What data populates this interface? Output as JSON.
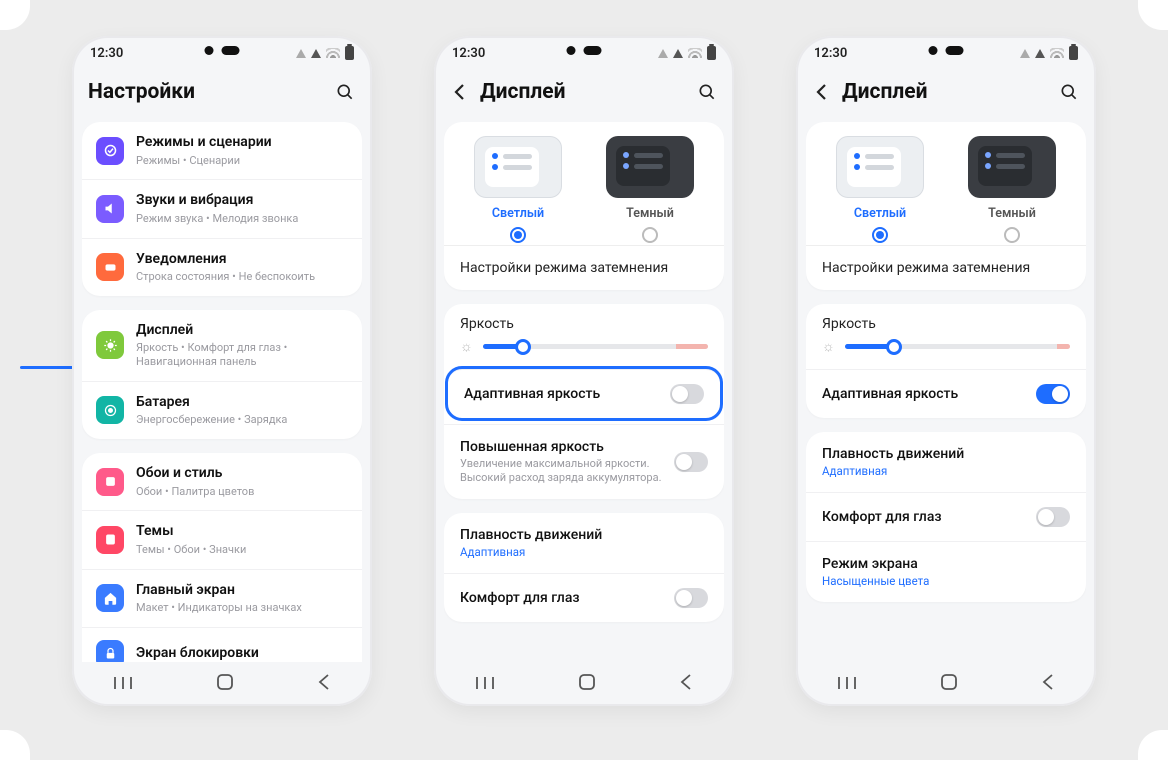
{
  "status_time": "12:30",
  "phone1": {
    "title": "Настройки",
    "groups": [
      {
        "items": [
          {
            "icon": "modes",
            "color": "#6b4eff",
            "title": "Режимы и сценарии",
            "sub": "Режимы  •  Сценарии"
          },
          {
            "icon": "sound",
            "color": "#7b5cff",
            "title": "Звуки и вибрация",
            "sub": "Режим звука  •  Мелодия звонка"
          },
          {
            "icon": "notif",
            "color": "#ff6a3d",
            "title": "Уведомления",
            "sub": "Строка состояния  •  Не беспокоить"
          }
        ]
      },
      {
        "items": [
          {
            "icon": "display",
            "color": "#7fc93c",
            "title": "Дисплей",
            "sub": "Яркость  •  Комфорт для глаз  •  Навигационная панель",
            "point": true
          },
          {
            "icon": "battery",
            "color": "#12b5a5",
            "title": "Батарея",
            "sub": "Энергосбережение  •  Зарядка"
          }
        ]
      },
      {
        "items": [
          {
            "icon": "wall",
            "color": "#ff5a8a",
            "title": "Обои и стиль",
            "sub": "Обои  •  Палитра цветов"
          },
          {
            "icon": "themes",
            "color": "#ff4765",
            "title": "Темы",
            "sub": "Темы  •  Обои  •  Значки"
          },
          {
            "icon": "home",
            "color": "#3a7bff",
            "title": "Главный экран",
            "sub": "Макет  •  Индикаторы на значках"
          },
          {
            "icon": "lock",
            "color": "#3a7bff",
            "title": "Экран блокировки",
            "sub": ""
          }
        ]
      }
    ]
  },
  "display_title": "Дисплей",
  "theme_light": "Светлый",
  "theme_dark": "Темный",
  "dark_mode_settings": "Настройки режима затемнения",
  "brightness_label": "Яркость",
  "adaptive_brightness": "Адаптивная яркость",
  "extra_brightness_title": "Повышенная яркость",
  "extra_brightness_sub": "Увеличение максимальной яркости. Высокий расход заряда аккумулятора.",
  "motion_title": "Плавность движений",
  "motion_value": "Адаптивная",
  "eye_comfort": "Комфорт для глаз",
  "screen_mode_title": "Режим экрана",
  "screen_mode_value": "Насыщенные цвета",
  "brightness_pct": 18
}
